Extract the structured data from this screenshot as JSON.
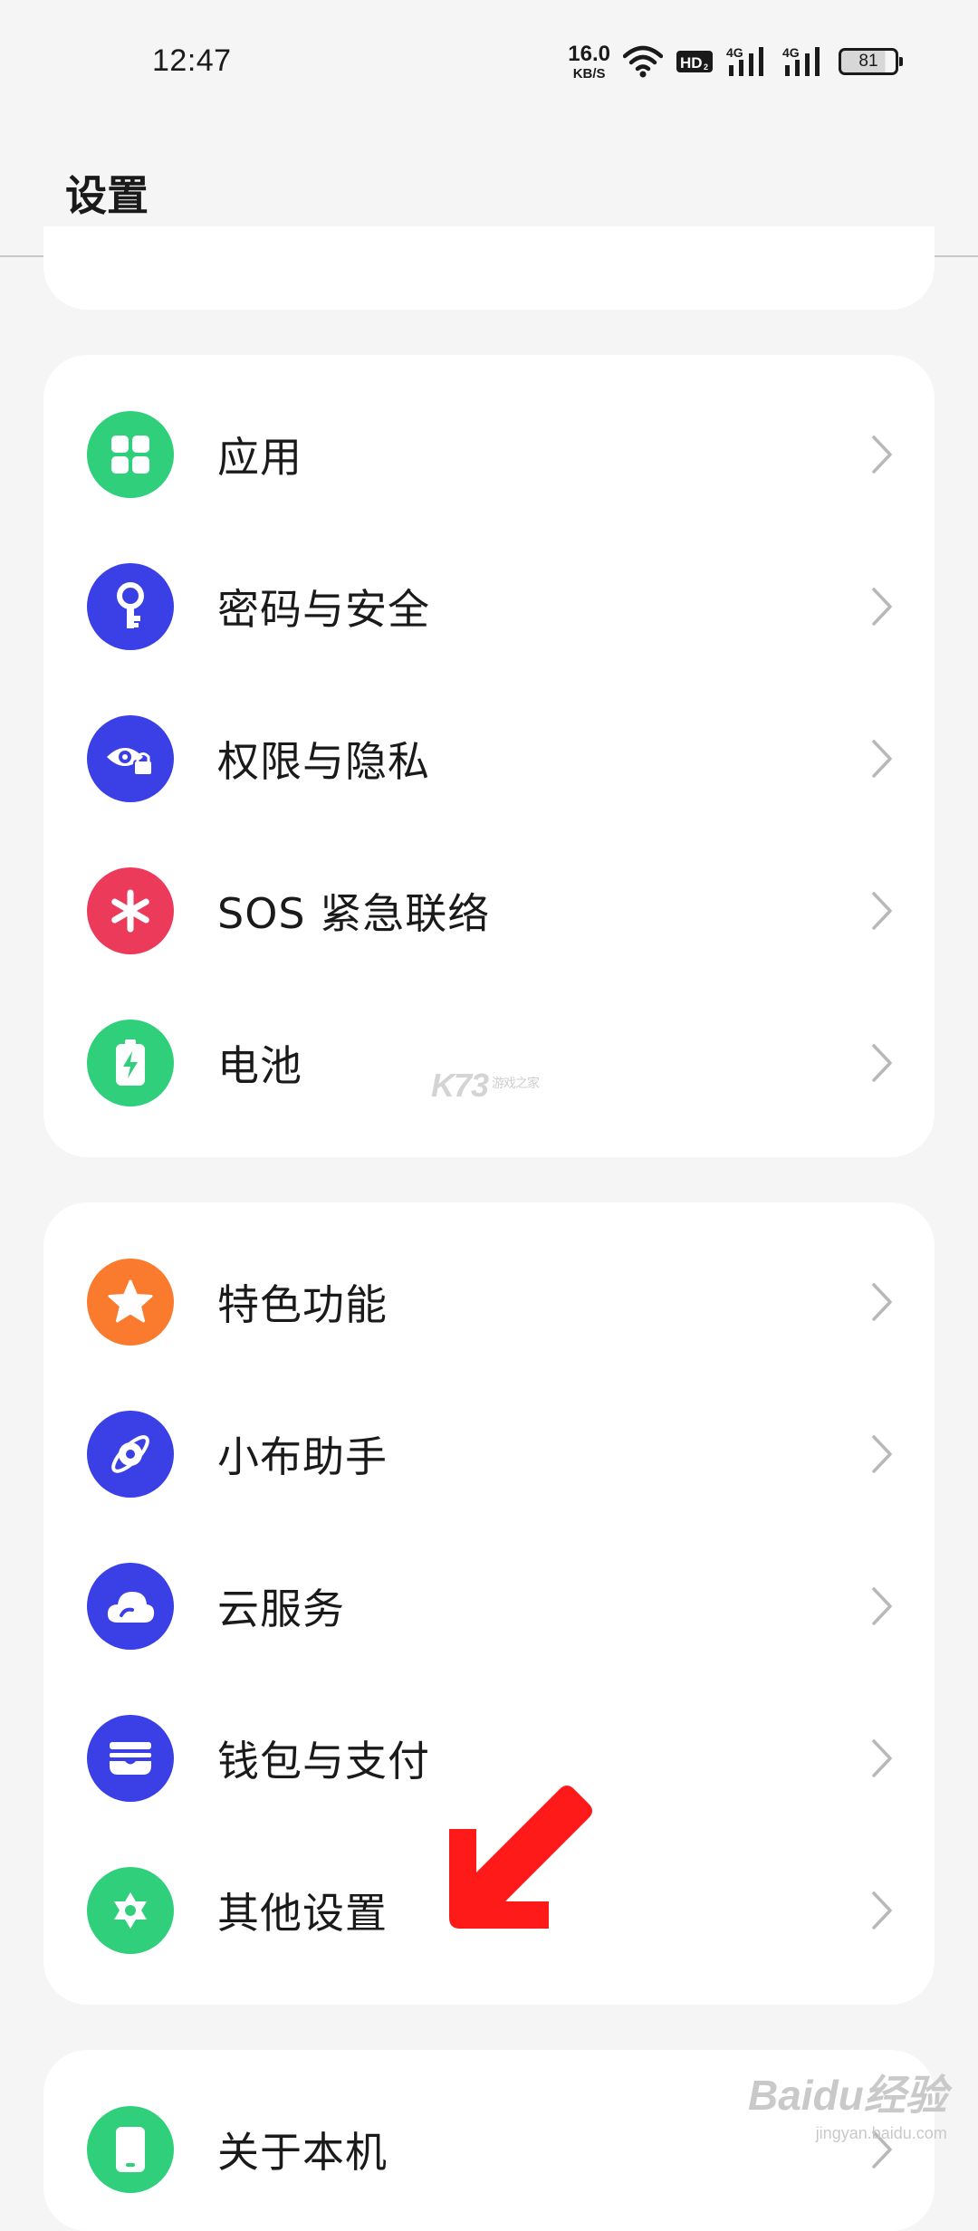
{
  "status_bar": {
    "time": "12:47",
    "net_speed_value": "16.0",
    "net_speed_unit": "KB/S",
    "hd_badge": "HD",
    "signal1_type": "4G",
    "signal2_type": "4G",
    "battery_level": "81",
    "icons": [
      "wifi-icon",
      "hd-icon",
      "signal-icon",
      "signal-icon",
      "battery-icon"
    ]
  },
  "header": {
    "title": "设置"
  },
  "groups": [
    {
      "items": [
        {
          "label": "应用",
          "icon": "apps-grid-icon",
          "color": "#2fcf7b"
        },
        {
          "label": "密码与安全",
          "icon": "key-icon",
          "color": "#3b40e6"
        },
        {
          "label": "权限与隐私",
          "icon": "privacy-eye-lock-icon",
          "color": "#3b40e6"
        },
        {
          "label": "SOS 紧急联络",
          "icon": "sos-asterisk-icon",
          "color": "#ec3a5a"
        },
        {
          "label": "电池",
          "icon": "battery-icon",
          "color": "#2fcf7b"
        }
      ]
    },
    {
      "items": [
        {
          "label": "特色功能",
          "icon": "star-icon",
          "color": "#fa7a2e"
        },
        {
          "label": "小布助手",
          "icon": "assistant-orbit-icon",
          "color": "#3b40e6"
        },
        {
          "label": "云服务",
          "icon": "cloud-icon",
          "color": "#3b40e6"
        },
        {
          "label": "钱包与支付",
          "icon": "wallet-icon",
          "color": "#3b40e6"
        },
        {
          "label": "其他设置",
          "icon": "gear-icon",
          "color": "#2fcf7b"
        }
      ]
    },
    {
      "items": [
        {
          "label": "关于本机",
          "icon": "phone-icon",
          "color": "#2fcf7b"
        }
      ]
    }
  ],
  "watermarks": {
    "k73": "K73",
    "k73_sub": "游戏之家",
    "baidu": "Baidu经验",
    "baidu_url": "jingyan.baidu.com"
  },
  "colors": {
    "background": "#f5f5f5",
    "card": "#ffffff",
    "green": "#2fcf7b",
    "blue": "#3b40e6",
    "red": "#ec3a5a",
    "orange": "#fa7a2e",
    "annotation_arrow": "#ff1a1a"
  }
}
